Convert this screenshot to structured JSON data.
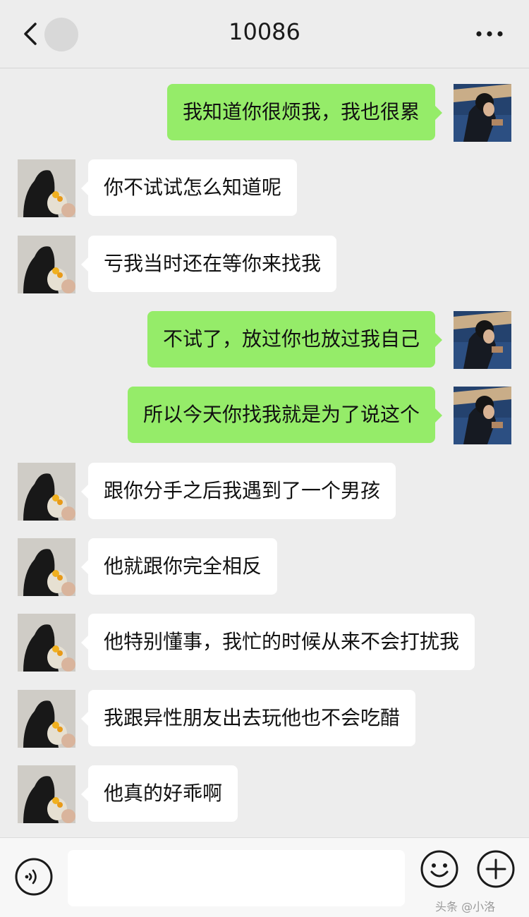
{
  "header": {
    "title": "10086",
    "back_icon": "chevron-left-icon",
    "more_icon": "more-dots-icon"
  },
  "messages": [
    {
      "side": "right",
      "text": "我知道你很烦我，我也很累",
      "avatar": "male-avatar"
    },
    {
      "side": "left",
      "text": "你不试试怎么知道呢",
      "avatar": "female-avatar"
    },
    {
      "side": "left",
      "text": "亏我当时还在等你来找我",
      "avatar": "female-avatar"
    },
    {
      "side": "right",
      "text": "不试了，放过你也放过我自己",
      "avatar": "male-avatar"
    },
    {
      "side": "right",
      "text": "所以今天你找我就是为了说这个",
      "avatar": "male-avatar"
    },
    {
      "side": "left",
      "text": "跟你分手之后我遇到了一个男孩",
      "avatar": "female-avatar"
    },
    {
      "side": "left",
      "text": "他就跟你完全相反",
      "avatar": "female-avatar"
    },
    {
      "side": "left",
      "text": "他特别懂事，我忙的时候从来不会打扰我",
      "avatar": "female-avatar"
    },
    {
      "side": "left",
      "text": "我跟异性朋友出去玩他也不会吃醋",
      "avatar": "female-avatar"
    },
    {
      "side": "left",
      "text": "他真的好乖啊",
      "avatar": "female-avatar"
    }
  ],
  "input_bar": {
    "voice_icon": "voice-icon",
    "emoji_icon": "emoji-icon",
    "plus_icon": "plus-icon",
    "placeholder": "",
    "watermark": "头条 @小洛"
  },
  "colors": {
    "background": "#ededed",
    "outgoing_bubble": "#95ec69",
    "incoming_bubble": "#ffffff"
  }
}
